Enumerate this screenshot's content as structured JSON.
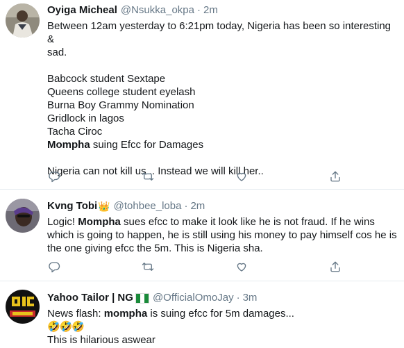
{
  "tweets": [
    {
      "name": "Oyiga Micheal",
      "handle": "@Nsukka_okpa",
      "time": "2m",
      "lines": [
        "Between 12am yesterday to 6:21pm today, Nigeria has been so interesting &",
        "sad.",
        "",
        "Babcock student Sextape",
        "Queens college student eyelash",
        "Burna Boy Grammy Nomination",
        "Gridlock in lagos",
        "Tacha Ciroc"
      ],
      "bold_line_strong": "Mompha",
      "bold_line_rest": " suing Efcc for Damages",
      "last_line": "Nigeria can not kill us .. Instead we will kill her.."
    },
    {
      "name": "Kvng Tobi",
      "handle": "@tohbee_loba",
      "time": "2m",
      "line1_pre": "Logic! ",
      "line1_strong": "Mompha",
      "line1_post": " sues efcc to make it look like he is not fraud. If he wins",
      "line2": "which is going to happen, he is still using his money to pay himself cos he is",
      "line3": "the one giving efcc the 5m. This is Nigeria sha."
    },
    {
      "name": "Yahoo Tailor | NG",
      "handle": "@OfficialOmoJay",
      "time": "3m",
      "line1_pre": "News flash: ",
      "line1_strong": "mompha",
      "line1_post": " is suing efcc for 5m damages...",
      "emoji_line": "🤣🤣🤣",
      "line3": "This is hilarious aswear"
    }
  ],
  "separator": "·",
  "crown_emoji": "👑",
  "icons": [
    "reply-icon",
    "retweet-icon",
    "like-icon",
    "share-icon"
  ],
  "colors": {
    "text": "#14171a",
    "secondary": "#657786",
    "border": "#e6ecf0"
  }
}
